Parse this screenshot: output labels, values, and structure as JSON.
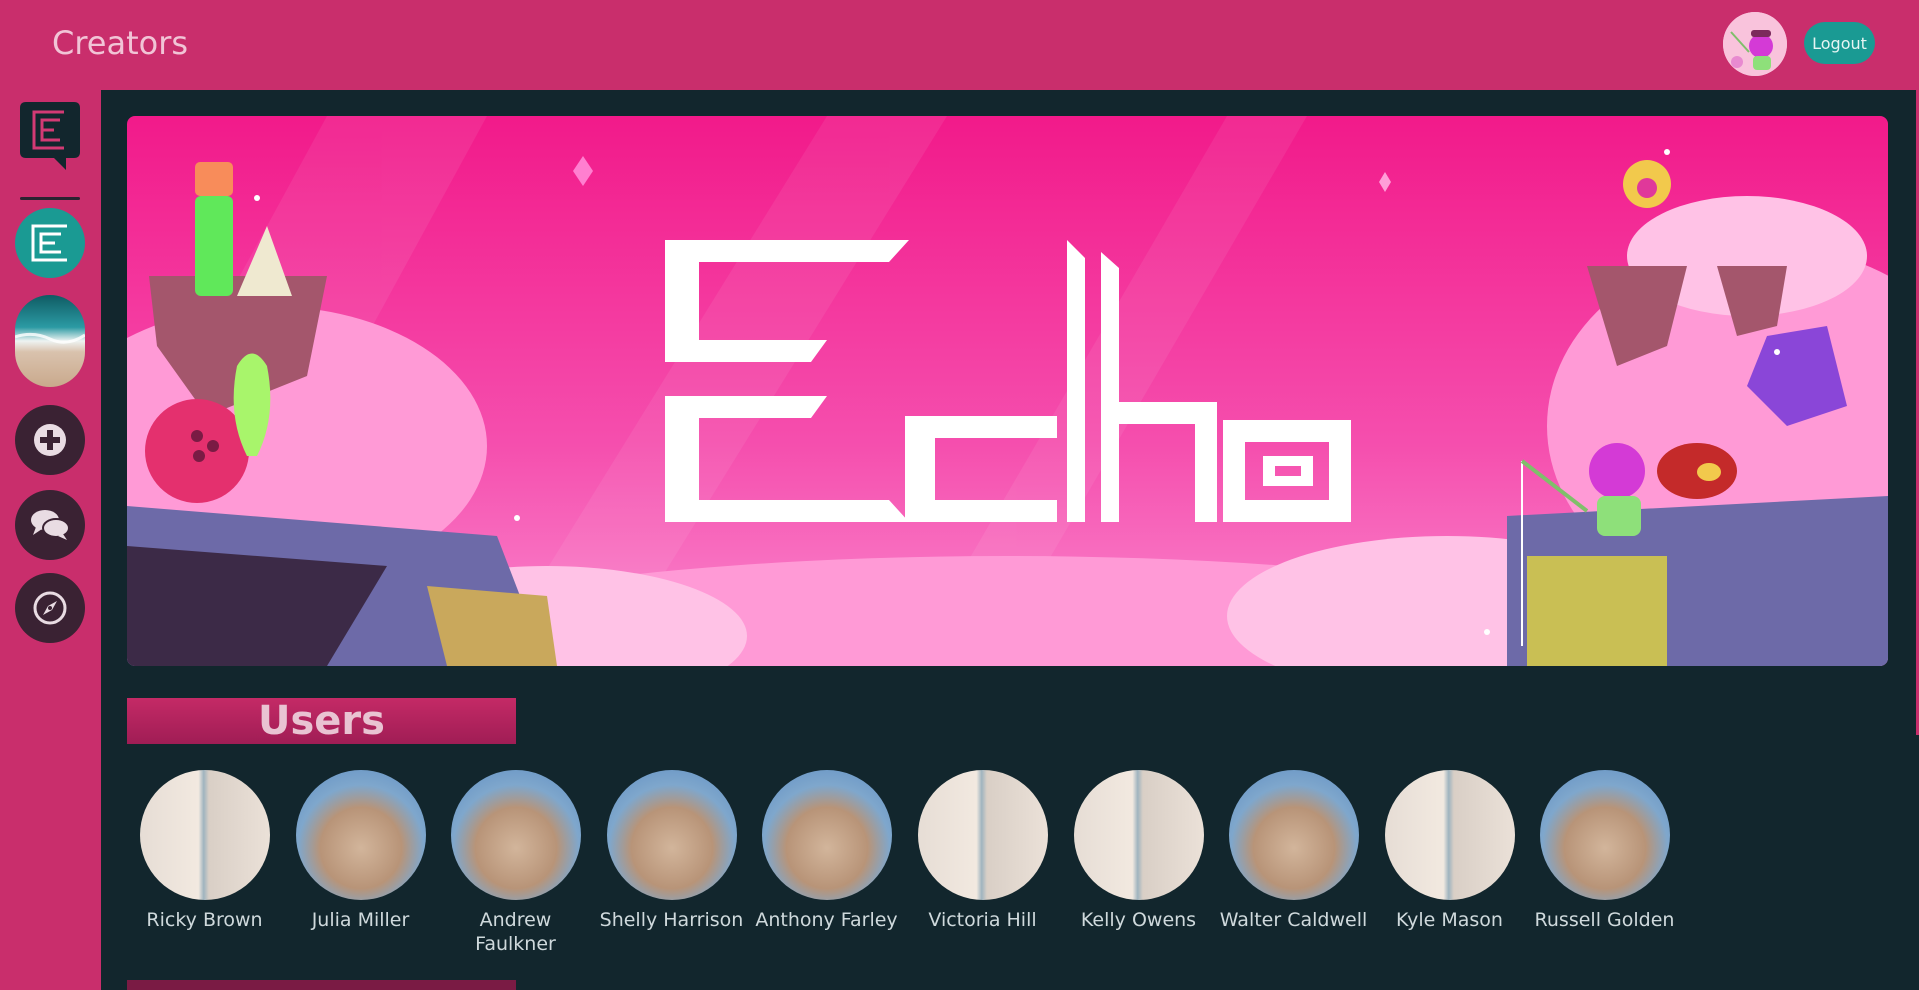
{
  "header": {
    "title": "Creators",
    "logout_label": "Logout"
  },
  "colors": {
    "brand": "#c92e6c",
    "panel": "#12262d",
    "accent": "#1a9a93"
  },
  "sidebar": {
    "icons": [
      "echo-logo-icon",
      "echo-server-icon",
      "ocean-server-icon",
      "plus-icon",
      "chat-icon",
      "compass-icon"
    ]
  },
  "banner": {
    "logo_text": "Echo"
  },
  "users_section": {
    "title": "Users",
    "users": [
      {
        "name": "Ricky Brown",
        "photo": "face"
      },
      {
        "name": "Julia Miller",
        "photo": "cat"
      },
      {
        "name": "Andrew Faulkner",
        "photo": "cat"
      },
      {
        "name": "Shelly Harrison",
        "photo": "cat"
      },
      {
        "name": "Anthony Farley",
        "photo": "cat"
      },
      {
        "name": "Victoria Hill",
        "photo": "face"
      },
      {
        "name": "Kelly Owens",
        "photo": "face"
      },
      {
        "name": "Walter Caldwell",
        "photo": "cat"
      },
      {
        "name": "Kyle Mason",
        "photo": "face"
      },
      {
        "name": "Russell Golden",
        "photo": "cat"
      }
    ]
  }
}
